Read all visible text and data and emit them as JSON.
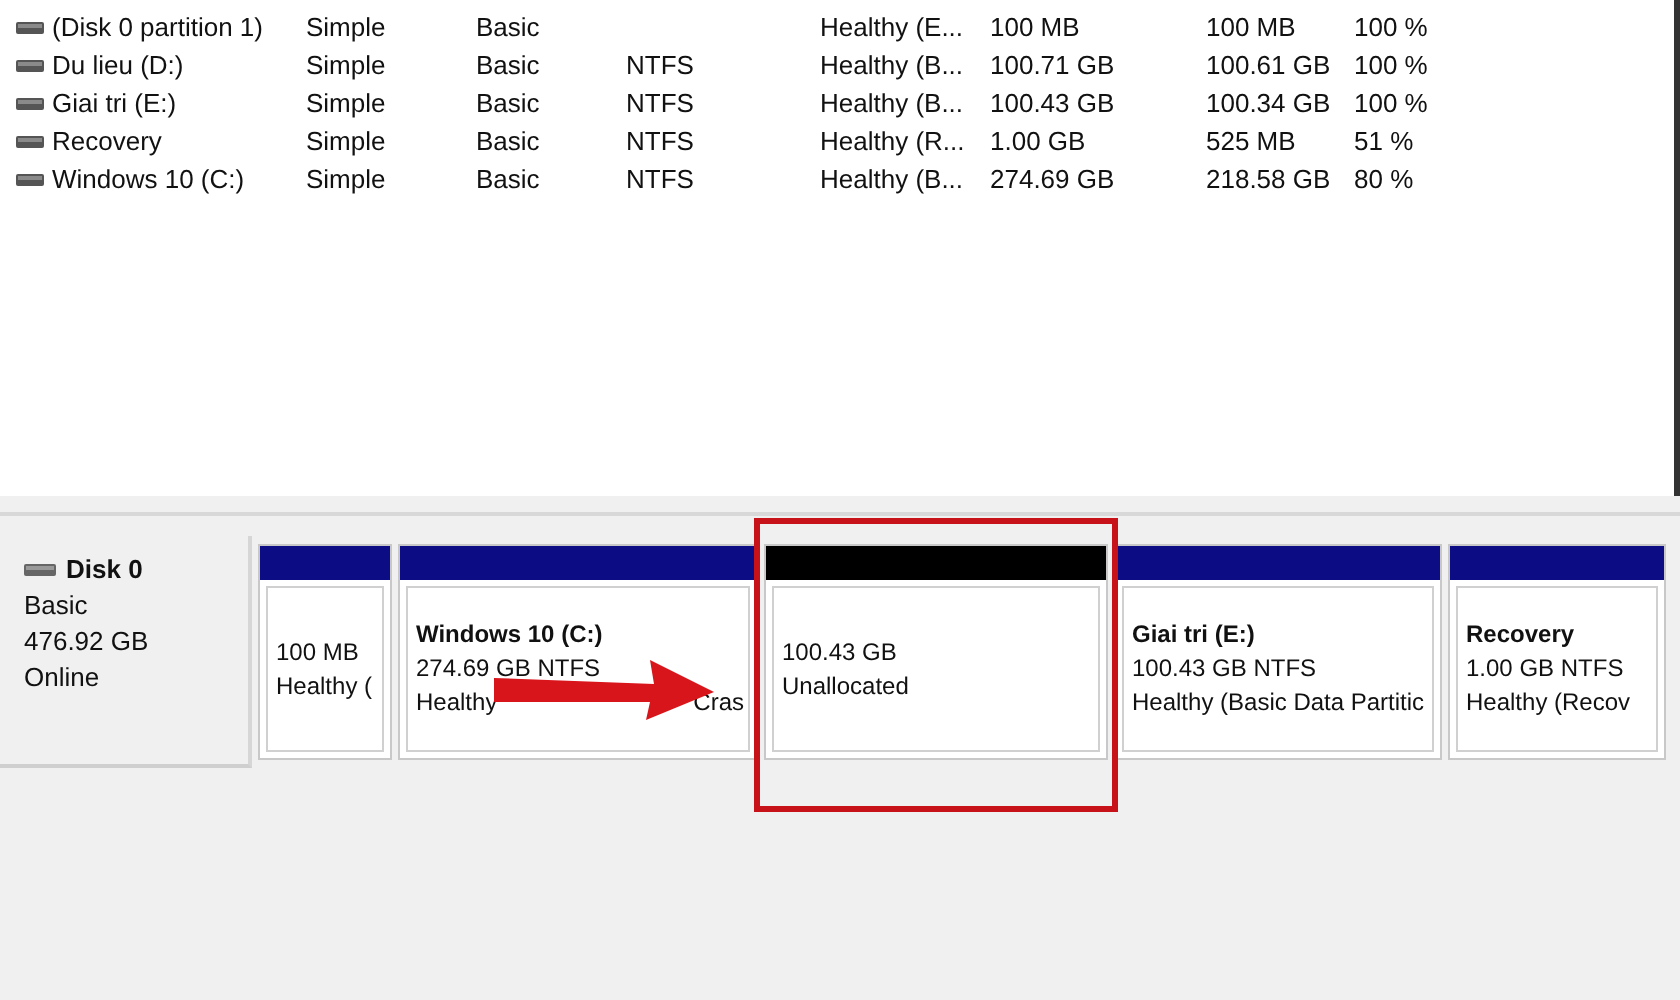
{
  "volumes": [
    {
      "name": "(Disk 0 partition 1)",
      "layout": "Simple",
      "type": "Basic",
      "status": "Healthy (E...",
      "capacity": "100 MB",
      "free_space": "100 MB",
      "percent_free": "100 %"
    },
    {
      "name": "Du lieu (D:)",
      "layout": "Simple",
      "type": "Basic",
      "file_system": "NTFS",
      "status": "Healthy (B...",
      "capacity": "100.71 GB",
      "free_space": "100.61 GB",
      "percent_free": "100 %"
    },
    {
      "name": "Giai tri (E:)",
      "layout": "Simple",
      "type": "Basic",
      "file_system": "NTFS",
      "status": "Healthy (B...",
      "capacity": "100.43 GB",
      "free_space": "100.34 GB",
      "percent_free": "100 %"
    },
    {
      "name": "Recovery",
      "layout": "Simple",
      "type": "Basic",
      "file_system": "NTFS",
      "status": "Healthy (R...",
      "capacity": "1.00 GB",
      "free_space": "525 MB",
      "percent_free": "51 %"
    },
    {
      "name": "Windows 10 (C:)",
      "layout": "Simple",
      "type": "Basic",
      "file_system": "NTFS",
      "status": "Healthy (B...",
      "capacity": "274.69 GB",
      "free_space": "218.58 GB",
      "percent_free": "80 %"
    }
  ],
  "disk": {
    "name": "Disk 0",
    "type": "Basic",
    "size": "476.92 GB",
    "state": "Online",
    "partitions": [
      {
        "kind": "primary",
        "size": "100 MB",
        "status": "Healthy ("
      },
      {
        "kind": "primary",
        "title": "Windows 10  (C:)",
        "size": "274.69 GB NTFS",
        "status": "Healthy",
        "status_end": "Cras"
      },
      {
        "kind": "unallocated",
        "size": "100.43 GB",
        "status": "Unallocated",
        "highlighted": true
      },
      {
        "kind": "primary",
        "title": "Giai tri  (E:)",
        "size": "100.43 GB NTFS",
        "status": "Healthy (Basic Data Partitic"
      },
      {
        "kind": "primary",
        "title": "Recovery",
        "size": "1.00 GB NTFS",
        "status": "Healthy (Recov"
      }
    ]
  },
  "annotation": {
    "arrow": true
  }
}
